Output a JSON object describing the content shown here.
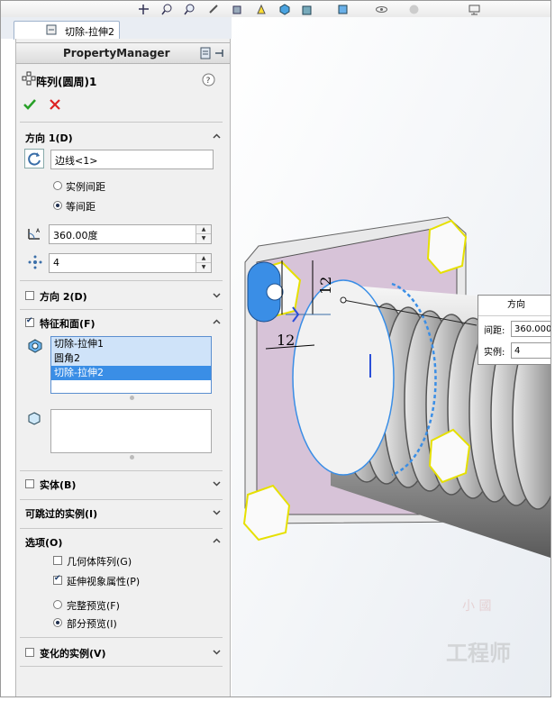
{
  "tab": {
    "label": "切除-拉伸2"
  },
  "property_manager": {
    "title": "PropertyManager",
    "feature_name": "阵列(圆周)1",
    "help": "?"
  },
  "direction1": {
    "header": "方向 1(D)",
    "edge_value": "边线<1>",
    "radio_instance_spacing": "实例间距",
    "radio_equal_spacing": "等间距",
    "angle_value": "360.00度",
    "count_value": "4"
  },
  "direction2": {
    "header": "方向 2(D)"
  },
  "features_faces": {
    "header": "特征和面(F)",
    "items": [
      "切除-拉伸1",
      "圆角2",
      "切除-拉伸2"
    ]
  },
  "bodies": {
    "header": "实体(B)"
  },
  "skippable": {
    "header": "可跳过的实例(I)"
  },
  "options": {
    "header": "选项(O)",
    "geometry_pattern": "几何体阵列(G)",
    "propagate_visual": "延伸视象属性(P)",
    "full_preview": "完整预览(F)",
    "partial_preview": "部分预览(I)"
  },
  "varied": {
    "header": "变化的实例(V)"
  },
  "viewport": {
    "dim1": "12",
    "dim2": "12",
    "callout_header": "方向",
    "callout_spacing_label": "间距:",
    "callout_spacing_value": "360.000",
    "callout_count_label": "实例:",
    "callout_count_value": "4"
  },
  "watermark": {
    "line1": "工程师",
    "line2": "小 國"
  },
  "colors": {
    "accent": "#3a8ee6",
    "plate": "#d7c3d8",
    "edge_highlight": "#f4f000"
  }
}
